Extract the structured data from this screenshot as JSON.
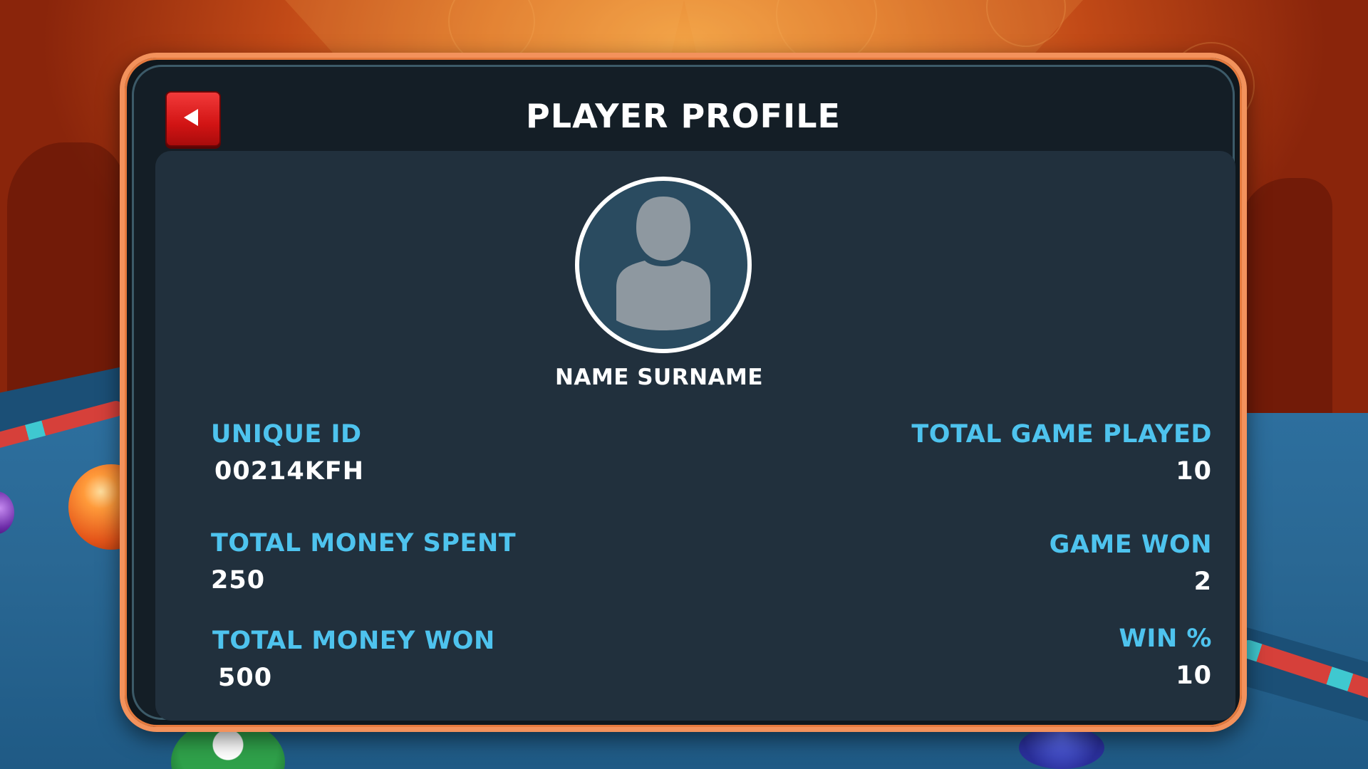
{
  "screen": {
    "title": "PLAYER PROFILE",
    "back_icon": "back-arrow-icon",
    "accent_color": "#f3925c",
    "label_color": "#4ec3ee",
    "back_button_color": "#e21c1c"
  },
  "profile": {
    "avatar_icon": "user-silhouette-icon",
    "name": "NAME SURNAME"
  },
  "stats": {
    "unique_id": {
      "label": "UNIQUE ID",
      "value": "00214KFH"
    },
    "total_money_spent": {
      "label": "TOTAL MONEY SPENT",
      "value": "250"
    },
    "total_money_won": {
      "label": "TOTAL MONEY WON",
      "value": "500"
    },
    "total_game_played": {
      "label": "TOTAL GAME PLAYED",
      "value": "10"
    },
    "game_won": {
      "label": "GAME WON",
      "value": "2"
    },
    "win_percent": {
      "label": "WIN %",
      "value": "10"
    }
  }
}
